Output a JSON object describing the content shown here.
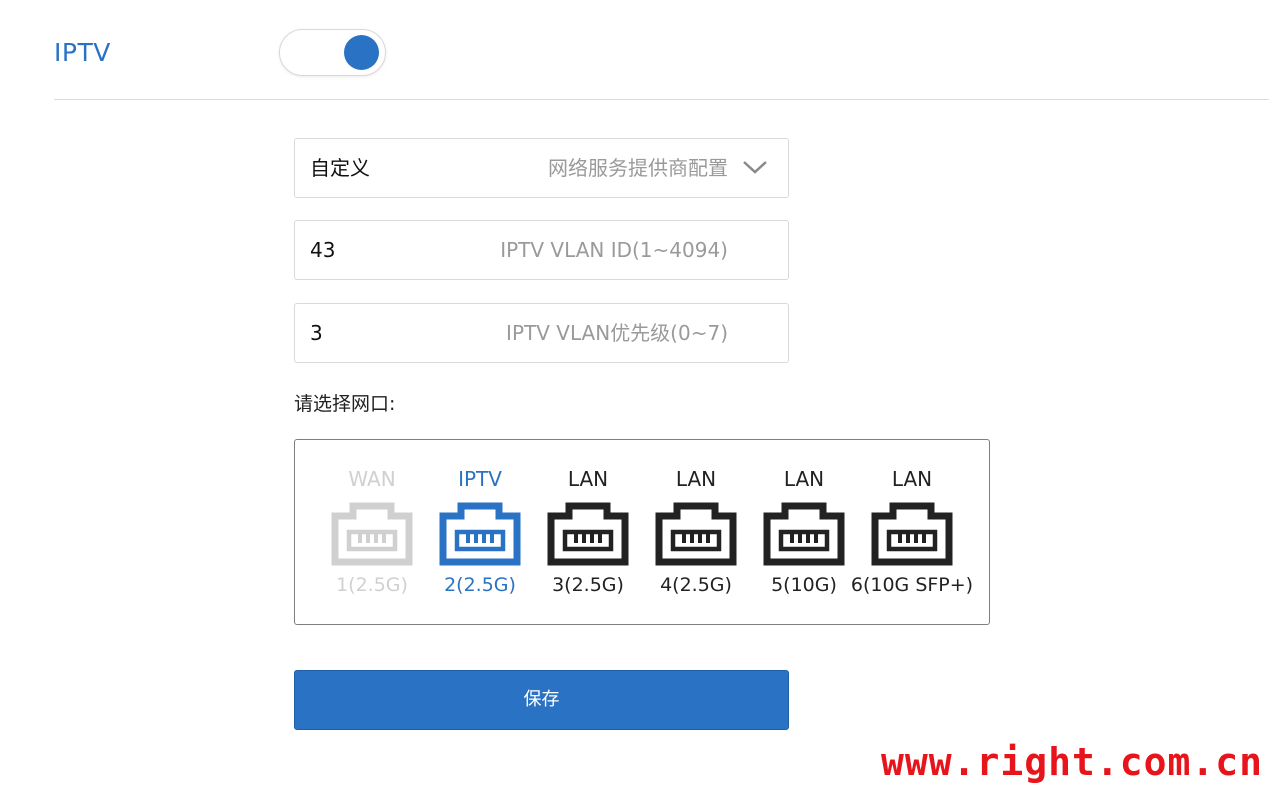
{
  "section": {
    "title": "IPTV",
    "enabled": true
  },
  "accent_color": "#2a73c4",
  "fields": {
    "profile": {
      "value": "自定义",
      "hint": "网络服务提供商配置",
      "icon": "chevron-down-icon"
    },
    "vlan_id": {
      "value": "43",
      "hint": "IPTV VLAN ID(1~4094)"
    },
    "vlan_priority": {
      "value": "3",
      "hint": "IPTV VLAN优先级(0~7)"
    }
  },
  "port_select": {
    "label": "请选择网口:",
    "ports": [
      {
        "label": "WAN",
        "speed": "1(2.5G)",
        "state": "disabled",
        "icon": "ethernet-port-icon"
      },
      {
        "label": "IPTV",
        "speed": "2(2.5G)",
        "state": "selected",
        "icon": "ethernet-port-icon"
      },
      {
        "label": "LAN",
        "speed": "3(2.5G)",
        "state": "normal",
        "icon": "ethernet-port-icon"
      },
      {
        "label": "LAN",
        "speed": "4(2.5G)",
        "state": "normal",
        "icon": "ethernet-port-icon"
      },
      {
        "label": "LAN",
        "speed": "5(10G)",
        "state": "normal",
        "icon": "ethernet-port-icon"
      },
      {
        "label": "LAN",
        "speed": "6(10G SFP+)",
        "state": "normal",
        "icon": "ethernet-port-icon"
      }
    ]
  },
  "save_label": "保存",
  "watermark": "www.right.com.cn"
}
